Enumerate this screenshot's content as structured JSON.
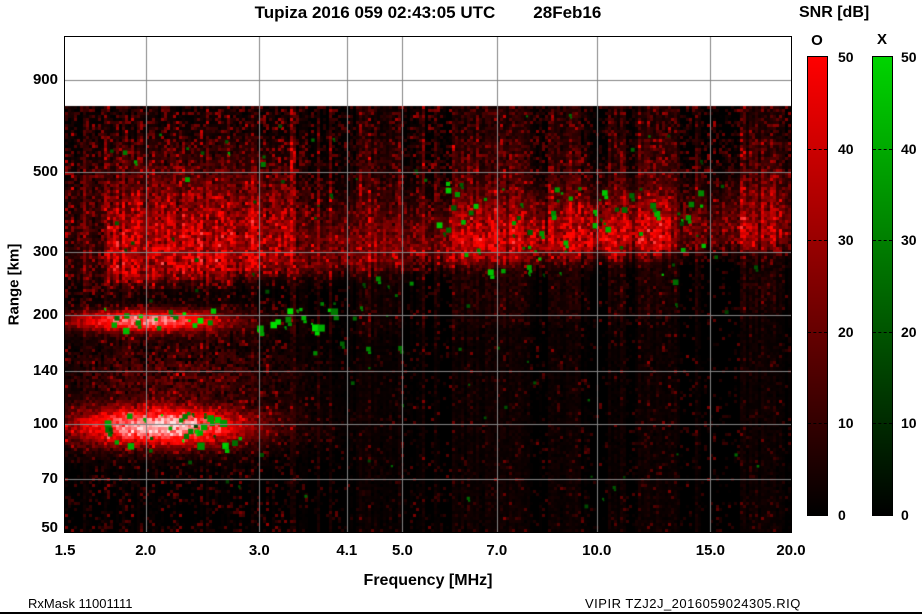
{
  "header": {
    "title": "Tupiza 2016 059 02:43:05 UTC",
    "date": "28Feb16"
  },
  "footer": {
    "left": "RxMask 11001111",
    "right": "VIPIR  TZJ2J_2016059024305.RIQ"
  },
  "colorbar": {
    "title": "SNR [dB]",
    "min": 0,
    "max": 50,
    "tick_values": [
      50,
      40,
      30,
      20,
      10,
      0
    ],
    "dashed_tick_values": [
      40,
      30,
      20,
      10
    ],
    "bars": [
      {
        "label": "O",
        "polarization": "ordinary",
        "color_top": "#ff0000",
        "color_bottom": "#000000"
      },
      {
        "label": "X",
        "polarization": "extraordinary",
        "color_top": "#00d400",
        "color_bottom": "#000000"
      }
    ]
  },
  "chart_data": {
    "type": "heatmap",
    "title": "Tupiza 2016 059 02:43:05 UTC 28Feb16",
    "xlabel": "Frequency [MHz]",
    "ylabel": "Range [km]",
    "x_scale": "log",
    "y_scale": "log",
    "x_range_mhz": [
      1.5,
      20.0
    ],
    "y_range_km": [
      50,
      1186
    ],
    "x_ticks": [
      {
        "value": 1.5,
        "label": "1.5"
      },
      {
        "value": 2.0,
        "label": "2.0"
      },
      {
        "value": 3.0,
        "label": "3.0"
      },
      {
        "value": 4.1,
        "label": "4.1"
      },
      {
        "value": 5.0,
        "label": "5.0"
      },
      {
        "value": 7.0,
        "label": "7.0"
      },
      {
        "value": 10.0,
        "label": "10.0"
      },
      {
        "value": 15.0,
        "label": "15.0"
      },
      {
        "value": 20.0,
        "label": "20.0"
      }
    ],
    "y_ticks": [
      {
        "value": 900,
        "label": "900"
      },
      {
        "value": 500,
        "label": "500"
      },
      {
        "value": 300,
        "label": "300"
      },
      {
        "value": 200,
        "label": "200"
      },
      {
        "value": 140,
        "label": "140"
      },
      {
        "value": 100,
        "label": "100"
      },
      {
        "value": 70,
        "label": "70"
      },
      {
        "value": 50,
        "label": "50"
      }
    ],
    "grid_color": "#848484",
    "background_signal": "black",
    "no_data_above_km": 760,
    "features": {
      "f_region_band": {
        "freq_mhz": [
          1.7,
          20.0
        ],
        "bottom_edge_km": [
          235,
          305
        ],
        "top_extent_km": 520,
        "segments": [
          {
            "freq_mhz": [
              1.5,
              1.75
            ],
            "strength": 0.15
          },
          {
            "freq_mhz": [
              1.75,
              3.4
            ],
            "strength": 0.95
          },
          {
            "freq_mhz": [
              3.4,
              5.8
            ],
            "strength": 0.55
          },
          {
            "freq_mhz": [
              5.8,
              13.0
            ],
            "strength": 1.0
          },
          {
            "freq_mhz": [
              13.0,
              16.2
            ],
            "strength": 0.45
          },
          {
            "freq_mhz": [
              16.2,
              20.0
            ],
            "strength": 0.65
          }
        ]
      },
      "e_region_echo": {
        "freq_mhz": [
          1.55,
          2.85
        ],
        "range_km": [
          88,
          112
        ],
        "saturated": true
      },
      "second_hop_echo": {
        "freq_mhz": [
          1.55,
          2.6
        ],
        "range_km": [
          183,
          207
        ],
        "saturated": true
      },
      "intermediate_layer": {
        "freq_mhz": [
          1.6,
          3.1
        ],
        "range_km": [
          118,
          168
        ],
        "strength": 0.5
      },
      "low_freq_spread": {
        "freq_mhz": [
          1.55,
          3.3
        ],
        "range_km": [
          300,
          550
        ],
        "strength": 0.3
      },
      "rfi_strong_freq_mhz": [
        [
          4.25,
          4.6
        ],
        [
          6.1,
          7.9
        ],
        [
          8.4,
          9.4
        ],
        [
          10.4,
          13.3
        ],
        [
          16.6,
          19.6
        ]
      ],
      "rfi_quiet_freq_mhz": [
        [
          11.05,
          11.5
        ],
        [
          13.6,
          14.1
        ],
        [
          15.05,
          16.3
        ]
      ],
      "x_mode_clusters": [
        {
          "freq_mhz": [
            1.72,
            2.8
          ],
          "range_km": [
            88,
            108
          ],
          "count": 26,
          "brightness": 1.0,
          "max_size_px": 8
        },
        {
          "freq_mhz": [
            1.72,
            2.55
          ],
          "range_km": [
            182,
            212
          ],
          "count": 17,
          "brightness": 1.0,
          "max_size_px": 8
        },
        {
          "freq_mhz": [
            2.95,
            3.9
          ],
          "range_km": [
            183,
            212
          ],
          "count": 15,
          "brightness": 0.95,
          "max_size_px": 8
        },
        {
          "freq_mhz": [
            5.4,
            14.6
          ],
          "range_km": [
            250,
            470
          ],
          "count": 60,
          "brightness": 0.85,
          "max_size_px": 6
        },
        {
          "freq_mhz": [
            3.3,
            5.3
          ],
          "range_km": [
            140,
            265
          ],
          "count": 12,
          "brightness": 0.6,
          "max_size_px": 5
        },
        {
          "freq_mhz": [
            1.8,
            3.1
          ],
          "range_km": [
            480,
            700
          ],
          "count": 9,
          "brightness": 0.7,
          "max_size_px": 5
        },
        {
          "freq_mhz": [
            1.55,
            19.5
          ],
          "range_km": [
            58,
            730
          ],
          "count": 80,
          "brightness": 0.4,
          "max_size_px": 4
        }
      ]
    }
  }
}
